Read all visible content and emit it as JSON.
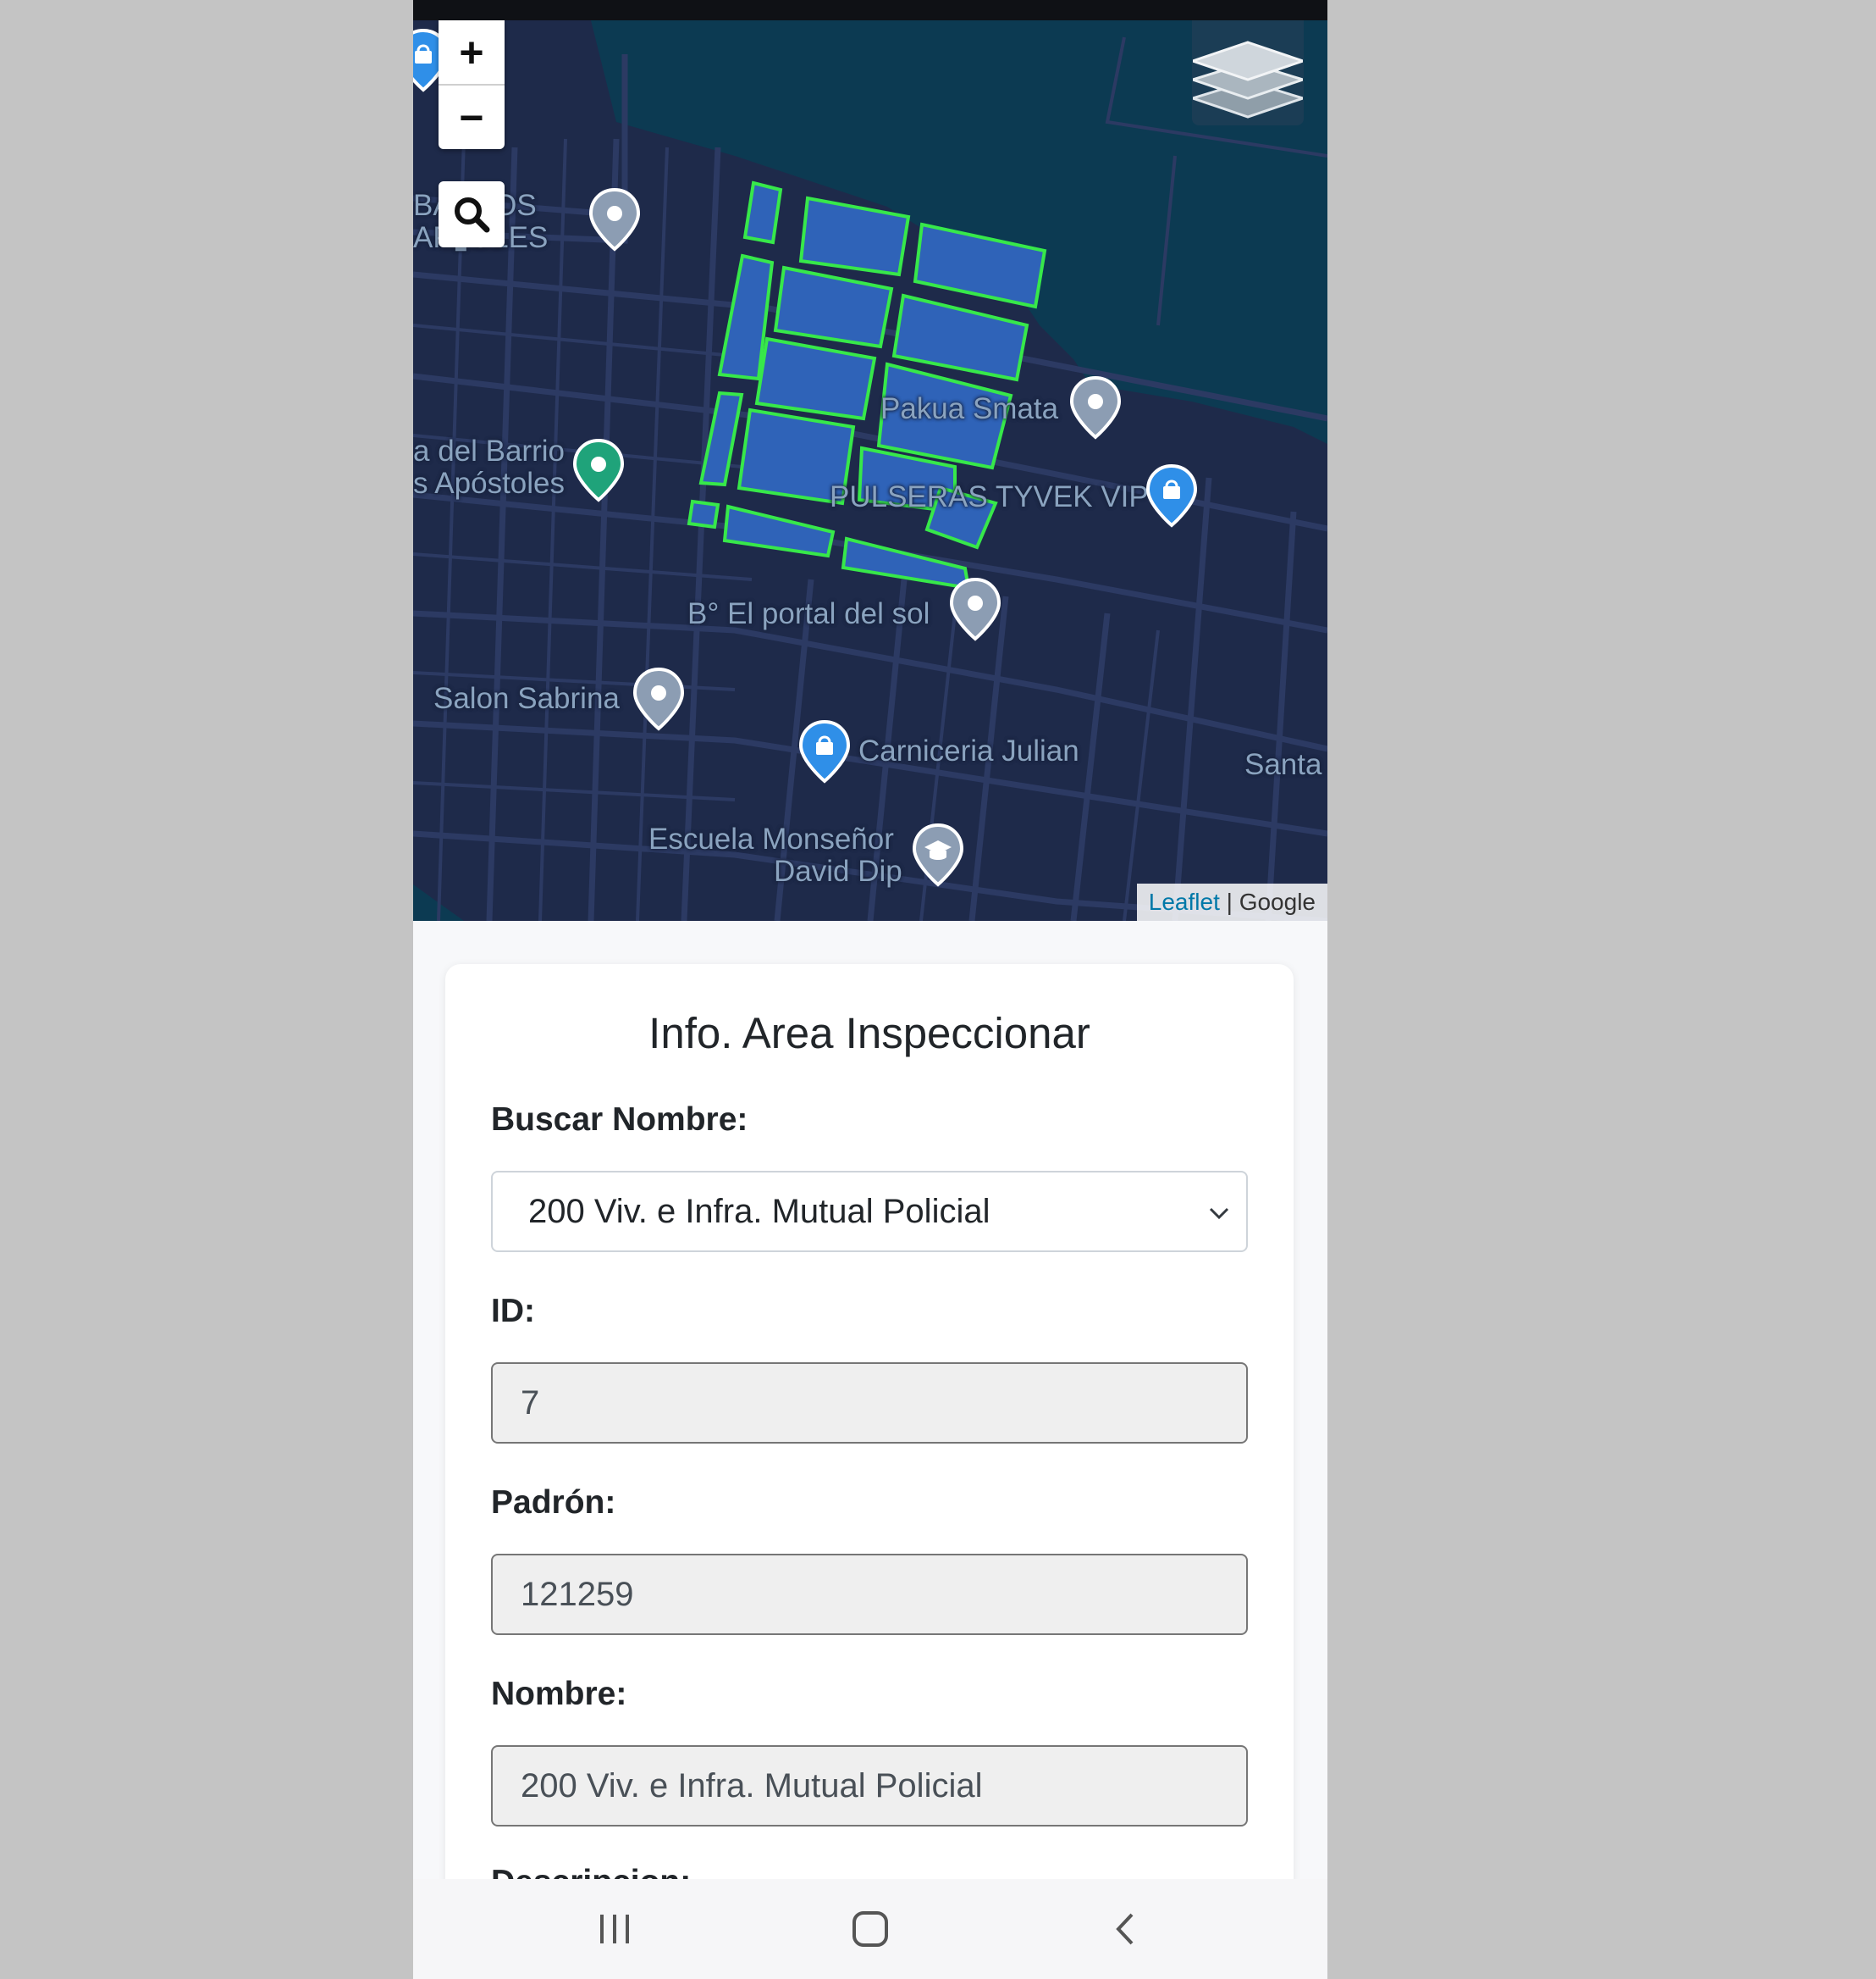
{
  "map": {
    "zoom_in_label": "+",
    "zoom_out_label": "−",
    "labels": [
      {
        "id": "barrio-top-1",
        "text": "BA▮ LOS"
      },
      {
        "id": "barrio-top-2",
        "text": "AP▮OLES"
      },
      {
        "id": "pakua",
        "text": "Pakua Smata"
      },
      {
        "id": "barrio-1",
        "text": "a del Barrio"
      },
      {
        "id": "barrio-2",
        "text": "s Apóstoles"
      },
      {
        "id": "pulseras",
        "text": "PULSERAS TYVEK VIP"
      },
      {
        "id": "portal",
        "text": "B° El portal del sol"
      },
      {
        "id": "salon",
        "text": "Salon Sabrina"
      },
      {
        "id": "carniceria",
        "text": "Carniceria Julian"
      },
      {
        "id": "santa",
        "text": "Santa"
      },
      {
        "id": "escuela-1",
        "text": "Escuela Monseñor"
      },
      {
        "id": "escuela-2",
        "text": "David Dip"
      }
    ],
    "attribution": {
      "leaflet": "Leaflet",
      "separator": " | ",
      "provider": "Google"
    },
    "colors": {
      "background": "#1e2a4a",
      "water": "#0c3a52",
      "parcel_fill": "#2f63b8",
      "parcel_stroke": "#37e84a"
    }
  },
  "form": {
    "title": "Info. Area Inspeccionar",
    "search_label": "Buscar Nombre:",
    "search_selected": "200 Viv. e Infra. Mutual Policial",
    "id_label": "ID:",
    "id_value": "7",
    "padron_label": "Padrón:",
    "padron_value": "121259",
    "nombre_label": "Nombre:",
    "nombre_value": "200 Viv. e Infra. Mutual Policial",
    "next_label_partial": "Descripcion:"
  },
  "navbar": {
    "icons": [
      "recent-apps-icon",
      "home-icon",
      "back-icon"
    ]
  }
}
